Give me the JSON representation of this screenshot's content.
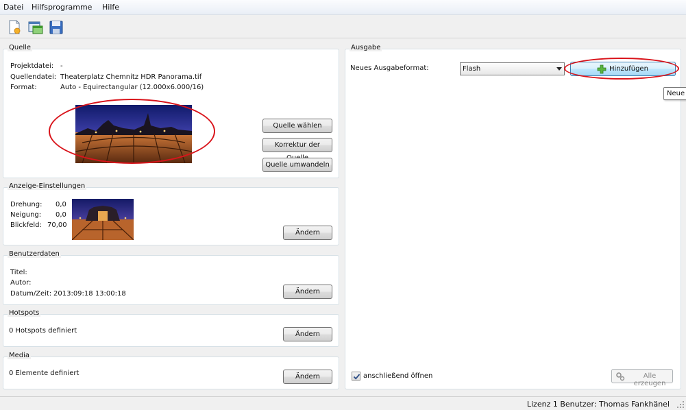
{
  "menu": [
    "Datei",
    "Hilfsprogramme",
    "Hilfe"
  ],
  "toolbar": {
    "icons": [
      "new-document-icon",
      "open-project-icon",
      "save-disk-icon"
    ]
  },
  "source": {
    "title": "Quelle",
    "project_label": "Projektdatei:",
    "project_value": "-",
    "file_label": "Quellendatei:",
    "file_value": "Theaterplatz Chemnitz HDR Panorama.tif",
    "format_label": "Format:",
    "format_value": "Auto - Equirectangular (12.000x6.000/16)",
    "choose_button": "Quelle wählen",
    "correct_button": "Korrektur der Quelle",
    "convert_button": "Quelle umwandeln"
  },
  "display": {
    "title": "Anzeige-Einstellungen",
    "rotation_label": "Drehung:",
    "rotation_value": "0,0",
    "tilt_label": "Neigung:",
    "tilt_value": "0,0",
    "fov_label": "Blickfeld:",
    "fov_value": "70,00",
    "change_button": "Ändern"
  },
  "userdata": {
    "title": "Benutzerdaten",
    "title_label": "Titel:",
    "author_label": "Autor:",
    "datetime_label": "Datum/Zeit:",
    "datetime_value": "2013:09:18 13:00:18",
    "change_button": "Ändern"
  },
  "hotspots": {
    "title": "Hotspots",
    "info": "0 Hotspots definiert",
    "change_button": "Ändern"
  },
  "media": {
    "title": "Media",
    "info": "0 Elemente definiert",
    "change_button": "Ändern"
  },
  "output": {
    "title": "Ausgabe",
    "format_label": "Neues Ausgabeformat:",
    "format_value": "Flash",
    "add_button": "Hinzufügen",
    "tooltip": "Neue",
    "open_after_label": "anschließend öffnen",
    "open_after_checked": true,
    "generate_all_button": "Alle erzeugen"
  },
  "status": {
    "text": "Lizenz 1 Benutzer: Thomas Fankhänel"
  },
  "colors": {
    "annotation_red": "#d9141b",
    "accent_blue": "#3c7fb1"
  }
}
